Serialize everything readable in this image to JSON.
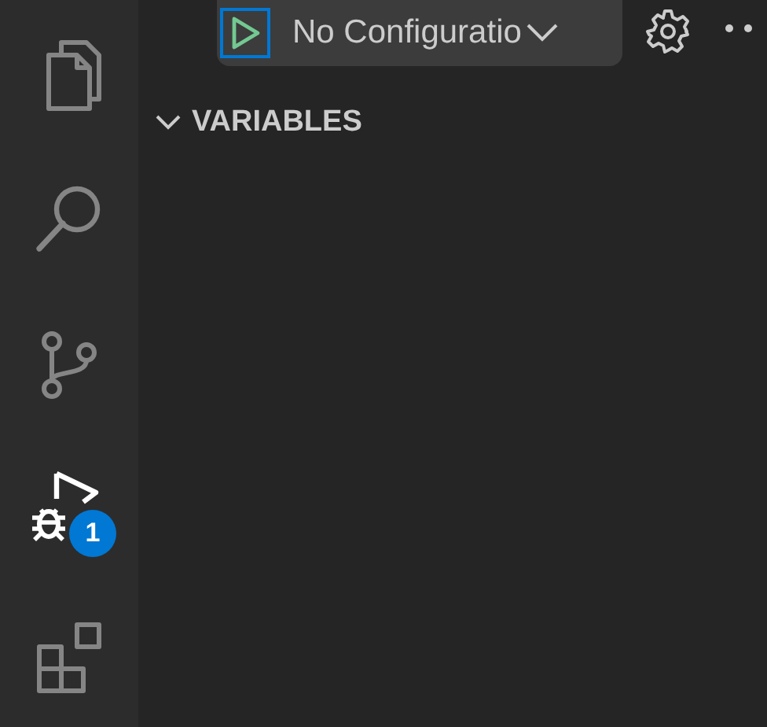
{
  "activity_bar": [
    {
      "kind": "explorer",
      "selected": false
    },
    {
      "kind": "search",
      "selected": false
    },
    {
      "kind": "source-control",
      "selected": false
    },
    {
      "kind": "debug",
      "selected": true,
      "badge": "1"
    },
    {
      "kind": "extensions",
      "selected": false
    }
  ],
  "debug_toolbar": {
    "configuration": "No Configuratio"
  },
  "sections": [
    {
      "title": "VARIABLES",
      "expanded": true
    }
  ]
}
